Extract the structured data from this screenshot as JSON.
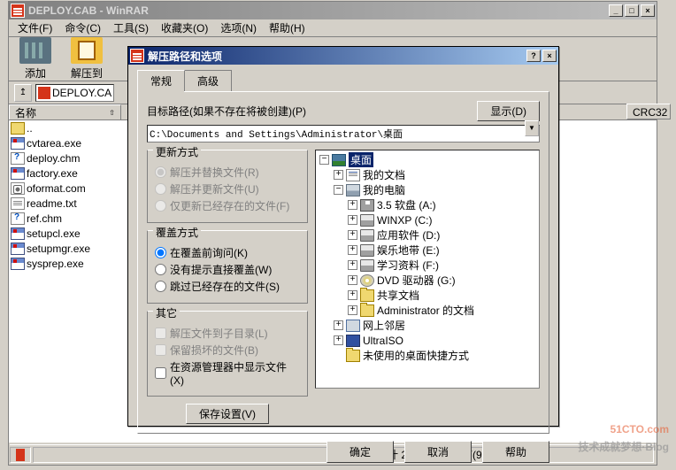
{
  "mainWindow": {
    "title": "DEPLOY.CAB - WinRAR",
    "minBtn": "_",
    "maxBtn": "□",
    "closeBtn": "×",
    "menu": {
      "file": "文件(F)",
      "cmd": "命令(C)",
      "tools": "工具(S)",
      "fav": "收藏夹(O)",
      "opt": "选项(N)",
      "help": "帮助(H)"
    },
    "toolbar": {
      "add": "添加",
      "extract": "解压到"
    },
    "upBtn": "↥",
    "addressField": "DEPLOY.CA",
    "columns": {
      "name": "名称",
      "crc": "CRC32",
      "sortArrow": "⇧"
    },
    "files": [
      {
        "icon": "updir",
        "name": ".."
      },
      {
        "icon": "exe",
        "name": "cvtarea.exe"
      },
      {
        "icon": "chm",
        "name": "deploy.chm"
      },
      {
        "icon": "exe",
        "name": "factory.exe"
      },
      {
        "icon": "com",
        "name": "oformat.com"
      },
      {
        "icon": "txt",
        "name": "readme.txt"
      },
      {
        "icon": "chm",
        "name": "ref.chm"
      },
      {
        "icon": "exe",
        "name": "setupcl.exe"
      },
      {
        "icon": "exe",
        "name": "setupmgr.exe"
      },
      {
        "icon": "exe",
        "name": "sysprep.exe"
      }
    ],
    "status": "总计 2,322,807 字节(9 个文件)"
  },
  "dialog": {
    "title": "解压路径和选项",
    "helpBtn": "?",
    "closeBtn": "×",
    "tabs": {
      "general": "常规",
      "advanced": "高级"
    },
    "destLabel": "目标路径(如果不存在将被创建)(P)",
    "displayBtn": "显示(D)",
    "pathValue": "C:\\Documents and Settings\\Administrator\\桌面",
    "groups": {
      "update": {
        "title": "更新方式",
        "r1": "解压并替换文件(R)",
        "r2": "解压并更新文件(U)",
        "r3": "仅更新已经存在的文件(F)"
      },
      "overwrite": {
        "title": "覆盖方式",
        "r1": "在覆盖前询问(K)",
        "r2": "没有提示直接覆盖(W)",
        "r3": "跳过已经存在的文件(S)"
      },
      "misc": {
        "title": "其它",
        "c1": "解压文件到子目录(L)",
        "c2": "保留损坏的文件(B)",
        "c3": "在资源管理器中显示文件(X)"
      }
    },
    "saveBtn": "保存设置(V)",
    "tree": {
      "desktop": "桌面",
      "mydocs": "我的文档",
      "mycomputer": "我的电脑",
      "floppy": "3.5 软盘 (A:)",
      "winxp": "WINXP (C:)",
      "apps": "应用软件 (D:)",
      "ent": "娱乐地带 (E:)",
      "study": "学习资料 (F:)",
      "dvd": "DVD 驱动器 (G:)",
      "shared": "共享文档",
      "admin": "Administrator 的文档",
      "network": "网上邻居",
      "iso": "UltraISO",
      "unused": "未使用的桌面快捷方式"
    },
    "buttons": {
      "ok": "确定",
      "cancel": "取消",
      "help": "帮助"
    }
  },
  "watermark": {
    "main": "51CTO.com",
    "sub": "技术成就梦想·Blog"
  }
}
